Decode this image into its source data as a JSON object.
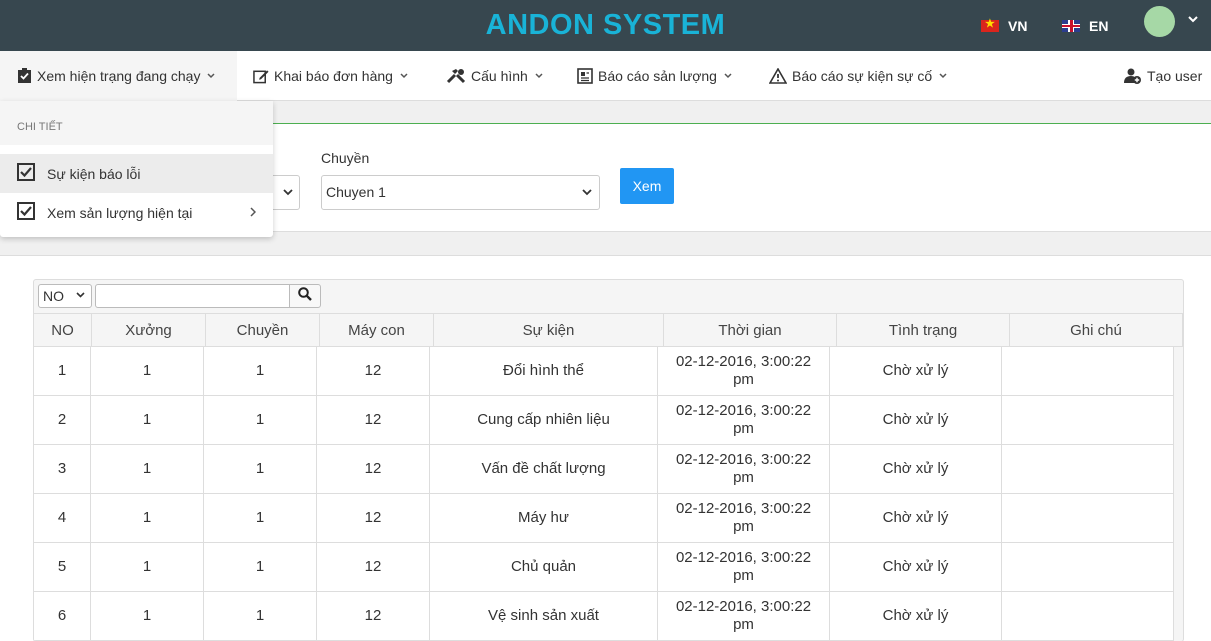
{
  "header": {
    "title": "ANDON SYSTEM",
    "lang_vn": "VN",
    "lang_en": "EN"
  },
  "nav": {
    "items": [
      {
        "label": "Xem hiện trạng đang chạy",
        "icon": "clipboard-check-icon"
      },
      {
        "label": "Khai báo đơn hàng",
        "icon": "edit-icon"
      },
      {
        "label": "Cấu hình",
        "icon": "tools-icon"
      },
      {
        "label": "Báo cáo sản lượng",
        "icon": "report-icon"
      },
      {
        "label": "Báo cáo sự kiện sự cố",
        "icon": "warning-icon"
      }
    ],
    "create_user": "Tạo user"
  },
  "dropdown": {
    "header": "CHI TIẾT",
    "items": [
      {
        "label": "Sự kiện báo lỗi"
      },
      {
        "label": "Xem sản lượng hiện tại"
      }
    ]
  },
  "filter": {
    "line_label": "Chuyền",
    "line_value": "Chuyen 1",
    "view_button": "Xem"
  },
  "table": {
    "page_size": "NO",
    "search_value": "",
    "columns": [
      "NO",
      "Xưởng",
      "Chuyền",
      "Máy con",
      "Sự kiện",
      "Thời gian",
      "Tình trạng",
      "Ghi chú"
    ],
    "rows": [
      [
        "1",
        "1",
        "1",
        "12",
        "Đổi hình thể",
        "02-12-2016, 3:00:22 pm",
        "Chờ xử lý",
        ""
      ],
      [
        "2",
        "1",
        "1",
        "12",
        "Cung cấp nhiên liệu",
        "02-12-2016, 3:00:22 pm",
        "Chờ xử lý",
        ""
      ],
      [
        "3",
        "1",
        "1",
        "12",
        "Vấn đề chất lượng",
        "02-12-2016, 3:00:22 pm",
        "Chờ xử lý",
        ""
      ],
      [
        "4",
        "1",
        "1",
        "12",
        "Máy hư",
        "02-12-2016, 3:00:22 pm",
        "Chờ xử lý",
        ""
      ],
      [
        "5",
        "1",
        "1",
        "12",
        "Chủ quản",
        "02-12-2016, 3:00:22 pm",
        "Chờ xử lý",
        ""
      ],
      [
        "6",
        "1",
        "1",
        "12",
        "Vệ sinh sản xuất",
        "02-12-2016, 3:00:22 pm",
        "Chờ xử lý",
        ""
      ]
    ]
  }
}
